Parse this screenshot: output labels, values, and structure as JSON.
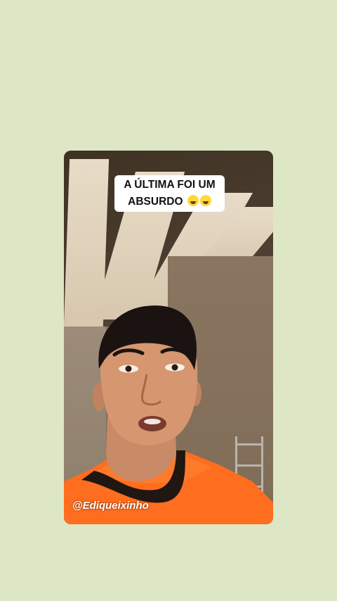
{
  "video": {
    "caption_line1": "A ÚLTIMA FOI UM",
    "caption_line2": "ABSURDO",
    "caption_emojis": [
      "rolling-on-floor-laughing",
      "rolling-on-floor-laughing"
    ],
    "watermark": "@Ediqueixinho"
  }
}
